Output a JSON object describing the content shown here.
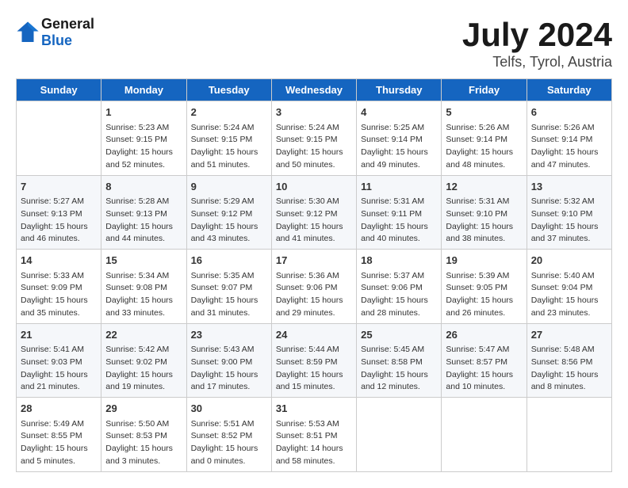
{
  "header": {
    "logo_line1": "General",
    "logo_line2": "Blue",
    "main_title": "July 2024",
    "subtitle": "Telfs, Tyrol, Austria"
  },
  "calendar": {
    "days_of_week": [
      "Sunday",
      "Monday",
      "Tuesday",
      "Wednesday",
      "Thursday",
      "Friday",
      "Saturday"
    ],
    "weeks": [
      [
        {
          "day": "",
          "info": ""
        },
        {
          "day": "1",
          "info": "Sunrise: 5:23 AM\nSunset: 9:15 PM\nDaylight: 15 hours\nand 52 minutes."
        },
        {
          "day": "2",
          "info": "Sunrise: 5:24 AM\nSunset: 9:15 PM\nDaylight: 15 hours\nand 51 minutes."
        },
        {
          "day": "3",
          "info": "Sunrise: 5:24 AM\nSunset: 9:15 PM\nDaylight: 15 hours\nand 50 minutes."
        },
        {
          "day": "4",
          "info": "Sunrise: 5:25 AM\nSunset: 9:14 PM\nDaylight: 15 hours\nand 49 minutes."
        },
        {
          "day": "5",
          "info": "Sunrise: 5:26 AM\nSunset: 9:14 PM\nDaylight: 15 hours\nand 48 minutes."
        },
        {
          "day": "6",
          "info": "Sunrise: 5:26 AM\nSunset: 9:14 PM\nDaylight: 15 hours\nand 47 minutes."
        }
      ],
      [
        {
          "day": "7",
          "info": "Sunrise: 5:27 AM\nSunset: 9:13 PM\nDaylight: 15 hours\nand 46 minutes."
        },
        {
          "day": "8",
          "info": "Sunrise: 5:28 AM\nSunset: 9:13 PM\nDaylight: 15 hours\nand 44 minutes."
        },
        {
          "day": "9",
          "info": "Sunrise: 5:29 AM\nSunset: 9:12 PM\nDaylight: 15 hours\nand 43 minutes."
        },
        {
          "day": "10",
          "info": "Sunrise: 5:30 AM\nSunset: 9:12 PM\nDaylight: 15 hours\nand 41 minutes."
        },
        {
          "day": "11",
          "info": "Sunrise: 5:31 AM\nSunset: 9:11 PM\nDaylight: 15 hours\nand 40 minutes."
        },
        {
          "day": "12",
          "info": "Sunrise: 5:31 AM\nSunset: 9:10 PM\nDaylight: 15 hours\nand 38 minutes."
        },
        {
          "day": "13",
          "info": "Sunrise: 5:32 AM\nSunset: 9:10 PM\nDaylight: 15 hours\nand 37 minutes."
        }
      ],
      [
        {
          "day": "14",
          "info": "Sunrise: 5:33 AM\nSunset: 9:09 PM\nDaylight: 15 hours\nand 35 minutes."
        },
        {
          "day": "15",
          "info": "Sunrise: 5:34 AM\nSunset: 9:08 PM\nDaylight: 15 hours\nand 33 minutes."
        },
        {
          "day": "16",
          "info": "Sunrise: 5:35 AM\nSunset: 9:07 PM\nDaylight: 15 hours\nand 31 minutes."
        },
        {
          "day": "17",
          "info": "Sunrise: 5:36 AM\nSunset: 9:06 PM\nDaylight: 15 hours\nand 29 minutes."
        },
        {
          "day": "18",
          "info": "Sunrise: 5:37 AM\nSunset: 9:06 PM\nDaylight: 15 hours\nand 28 minutes."
        },
        {
          "day": "19",
          "info": "Sunrise: 5:39 AM\nSunset: 9:05 PM\nDaylight: 15 hours\nand 26 minutes."
        },
        {
          "day": "20",
          "info": "Sunrise: 5:40 AM\nSunset: 9:04 PM\nDaylight: 15 hours\nand 23 minutes."
        }
      ],
      [
        {
          "day": "21",
          "info": "Sunrise: 5:41 AM\nSunset: 9:03 PM\nDaylight: 15 hours\nand 21 minutes."
        },
        {
          "day": "22",
          "info": "Sunrise: 5:42 AM\nSunset: 9:02 PM\nDaylight: 15 hours\nand 19 minutes."
        },
        {
          "day": "23",
          "info": "Sunrise: 5:43 AM\nSunset: 9:00 PM\nDaylight: 15 hours\nand 17 minutes."
        },
        {
          "day": "24",
          "info": "Sunrise: 5:44 AM\nSunset: 8:59 PM\nDaylight: 15 hours\nand 15 minutes."
        },
        {
          "day": "25",
          "info": "Sunrise: 5:45 AM\nSunset: 8:58 PM\nDaylight: 15 hours\nand 12 minutes."
        },
        {
          "day": "26",
          "info": "Sunrise: 5:47 AM\nSunset: 8:57 PM\nDaylight: 15 hours\nand 10 minutes."
        },
        {
          "day": "27",
          "info": "Sunrise: 5:48 AM\nSunset: 8:56 PM\nDaylight: 15 hours\nand 8 minutes."
        }
      ],
      [
        {
          "day": "28",
          "info": "Sunrise: 5:49 AM\nSunset: 8:55 PM\nDaylight: 15 hours\nand 5 minutes."
        },
        {
          "day": "29",
          "info": "Sunrise: 5:50 AM\nSunset: 8:53 PM\nDaylight: 15 hours\nand 3 minutes."
        },
        {
          "day": "30",
          "info": "Sunrise: 5:51 AM\nSunset: 8:52 PM\nDaylight: 15 hours\nand 0 minutes."
        },
        {
          "day": "31",
          "info": "Sunrise: 5:53 AM\nSunset: 8:51 PM\nDaylight: 14 hours\nand 58 minutes."
        },
        {
          "day": "",
          "info": ""
        },
        {
          "day": "",
          "info": ""
        },
        {
          "day": "",
          "info": ""
        }
      ]
    ]
  }
}
